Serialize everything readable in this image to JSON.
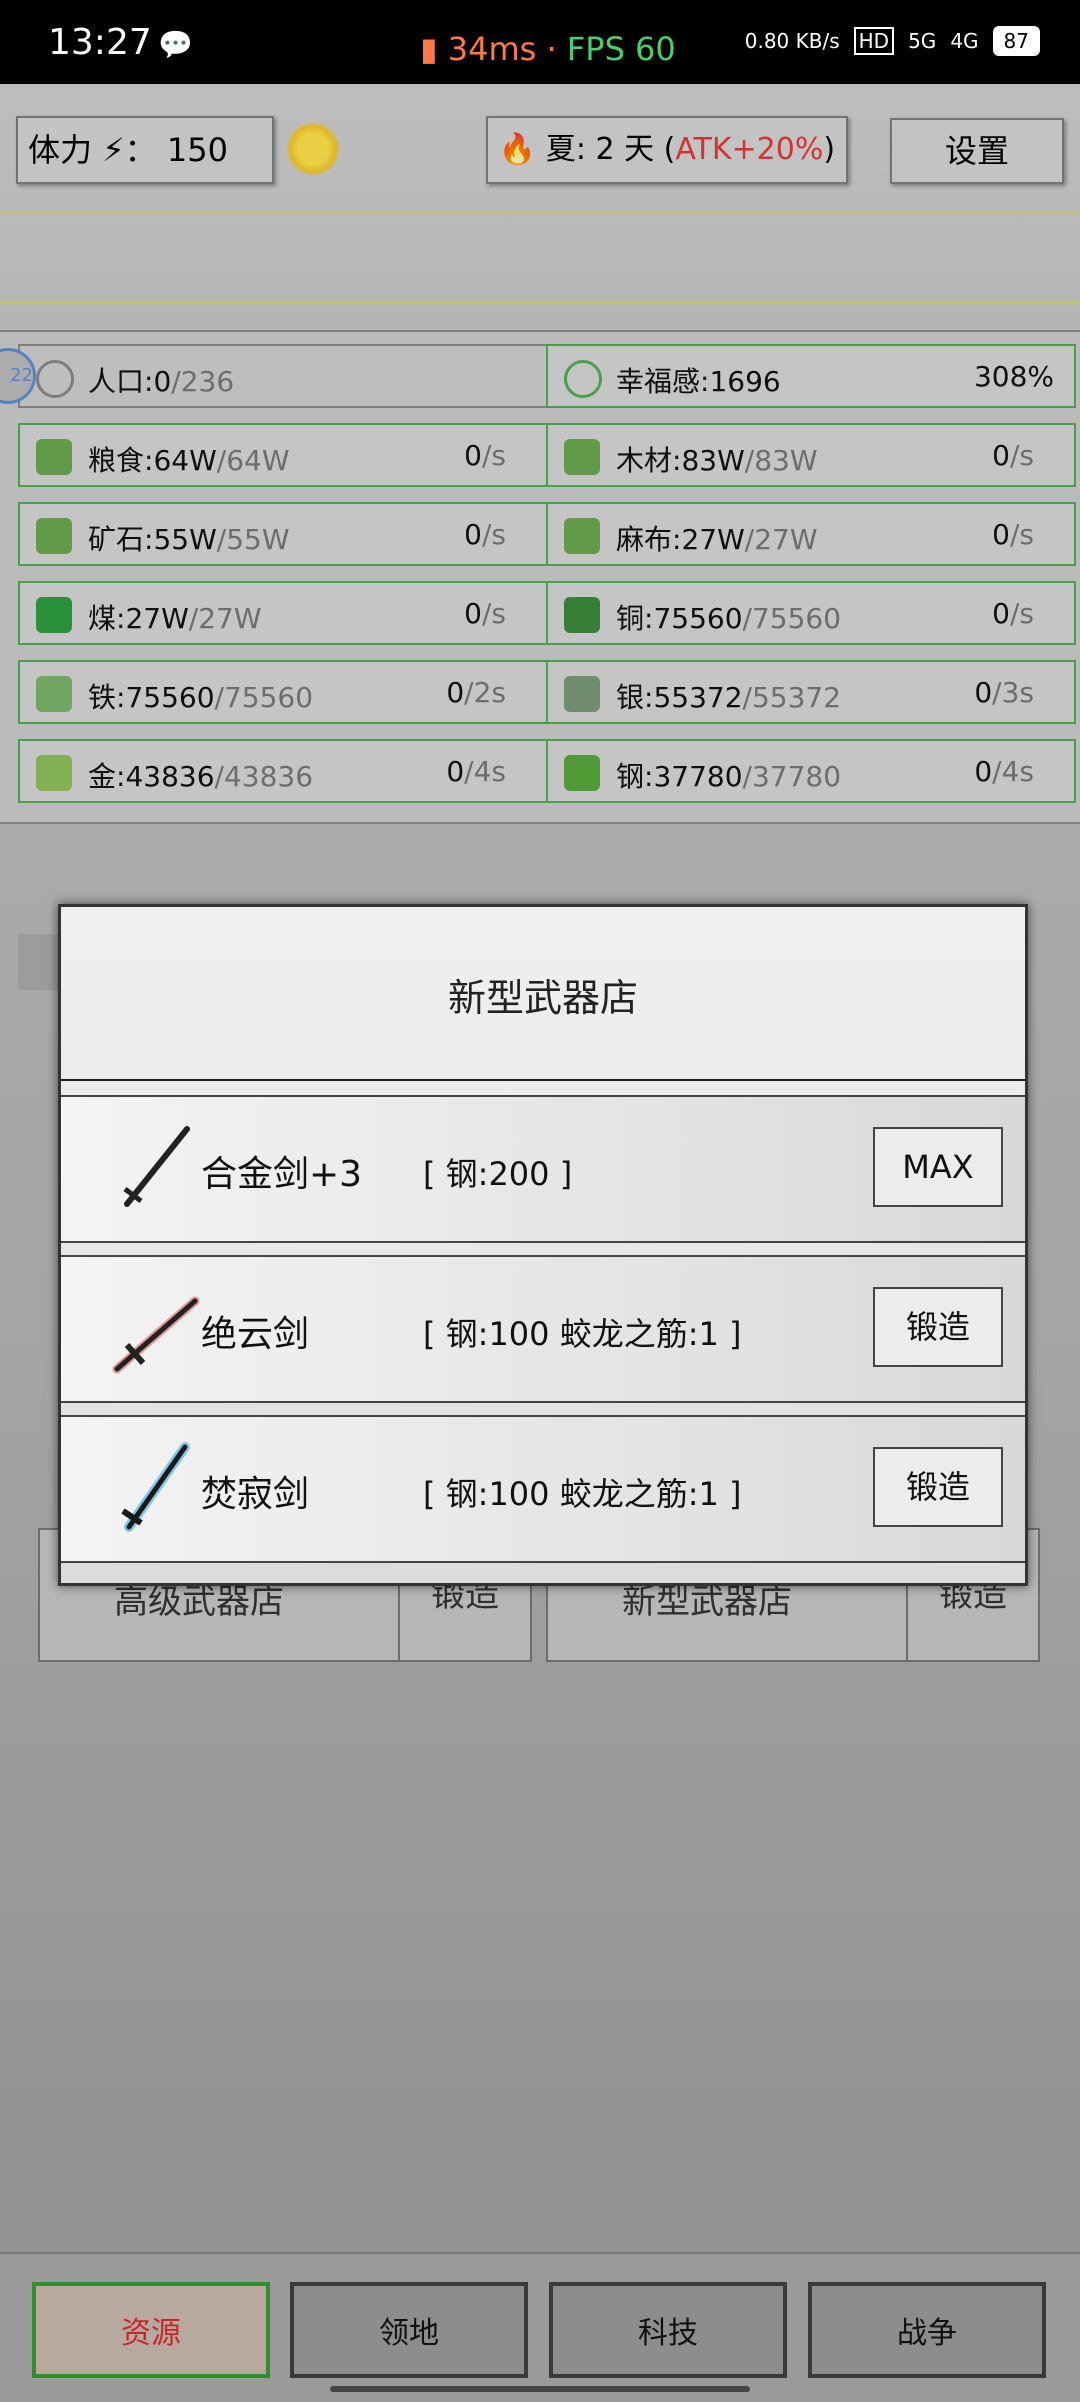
{
  "status": {
    "time": "13:27",
    "chat_icon": "wechat-icon",
    "ping": "34ms",
    "separator": "·",
    "fps": "FPS 60",
    "net_speed": "0.80 KB/s",
    "signal_a": "HD",
    "signal_b": "5G",
    "signal_c": "4G",
    "battery": "87"
  },
  "topbar": {
    "stamina_label": "体力",
    "stamina_sep": "：",
    "stamina_value": "150",
    "season_prefix": "夏: 2 天 (",
    "season_bonus": "ATK+20%",
    "season_suffix": ")",
    "settings_label": "设置"
  },
  "resources": [
    {
      "name": "人口:",
      "cur": "0",
      "cap": "/236",
      "rate": "",
      "unit": "",
      "color": "#888888"
    },
    {
      "name": "幸福感:",
      "cur": "1696",
      "cap": "",
      "rate": "308%",
      "unit": "",
      "color": "#4caf50"
    },
    {
      "name": "粮食:",
      "cur": "64W",
      "cap": "/64W",
      "rate": "0",
      "unit": "/s",
      "color": "#6aa84f"
    },
    {
      "name": "木材:",
      "cur": "83W",
      "cap": "/83W",
      "rate": "0",
      "unit": "/s",
      "color": "#6aa84f"
    },
    {
      "name": "矿石:",
      "cur": "55W",
      "cap": "/55W",
      "rate": "0",
      "unit": "/s",
      "color": "#6aa84f"
    },
    {
      "name": "麻布:",
      "cur": "27W",
      "cap": "/27W",
      "rate": "0",
      "unit": "/s",
      "color": "#6aa84f"
    },
    {
      "name": "煤:",
      "cur": "27W",
      "cap": "/27W",
      "rate": "0",
      "unit": "/s",
      "color": "#2e9e3e"
    },
    {
      "name": "铜:",
      "cur": "75560",
      "cap": "/75560",
      "rate": "0",
      "unit": "/s",
      "color": "#3c8a3c"
    },
    {
      "name": "铁:",
      "cur": "75560",
      "cap": "/75560",
      "rate": "0",
      "unit": "/2s",
      "color": "#7bb36b"
    },
    {
      "name": "银:",
      "cur": "55372",
      "cap": "/55372",
      "rate": "0",
      "unit": "/3s",
      "color": "#7a9a7a"
    },
    {
      "name": "金:",
      "cur": "43836",
      "cap": "/43836",
      "rate": "0",
      "unit": "/4s",
      "color": "#8fbf5a"
    },
    {
      "name": "钢:",
      "cur": "37780",
      "cap": "/37780",
      "rate": "0",
      "unit": "/4s",
      "color": "#5aa83a"
    }
  ],
  "badge": "22",
  "background_shops": [
    {
      "label": "高级武器店",
      "button": "锻造"
    },
    {
      "label": "新型武器店",
      "button": "锻造"
    }
  ],
  "modal": {
    "title": "新型武器店",
    "items": [
      {
        "name": "合金剑+3",
        "cost": "[ 钢:200 ]",
        "action": "MAX",
        "sword_color": "#222222"
      },
      {
        "name": "绝云剑",
        "cost": "[ 钢:100   蛟龙之筋:1 ]",
        "action": "锻造",
        "sword_color": "#d9363e"
      },
      {
        "name": "焚寂剑",
        "cost": "[ 钢:100   蛟龙之筋:1 ]",
        "action": "锻造",
        "sword_color": "#2aa5e0"
      }
    ]
  },
  "nav": [
    {
      "label": "资源",
      "active": true
    },
    {
      "label": "领地",
      "active": false
    },
    {
      "label": "科技",
      "active": false
    },
    {
      "label": "战争",
      "active": false
    }
  ]
}
